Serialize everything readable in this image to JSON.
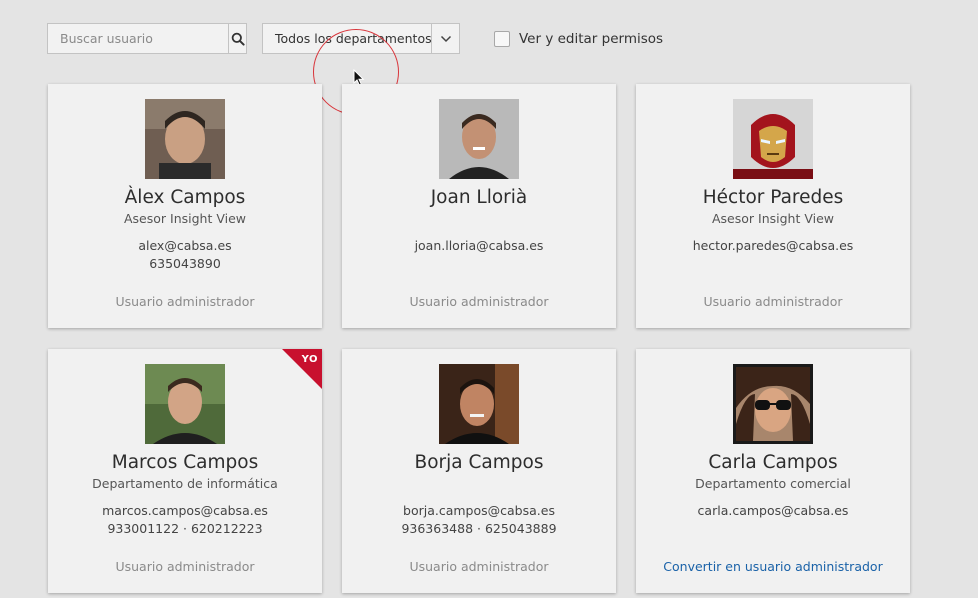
{
  "search": {
    "placeholder": "Buscar usuario",
    "value": ""
  },
  "department_filter": {
    "selected": "Todos los departamentos"
  },
  "permissions_toggle": {
    "label": "Ver y editar permisos",
    "checked": false
  },
  "users": [
    {
      "name": "Àlex Campos",
      "role": "Asesor Insight View",
      "email": "alex@cabsa.es",
      "phones": "635043890",
      "status": "Usuario administrador",
      "status_type": "text",
      "badge": ""
    },
    {
      "name": "Joan Llorià",
      "role": "",
      "email": "joan.lloria@cabsa.es",
      "phones": "",
      "status": "Usuario administrador",
      "status_type": "text",
      "badge": ""
    },
    {
      "name": "Héctor Paredes",
      "role": "Asesor Insight View",
      "email": "hector.paredes@cabsa.es",
      "phones": "",
      "status": "Usuario administrador",
      "status_type": "text",
      "badge": ""
    },
    {
      "name": "Marcos Campos",
      "role": "Departamento de informática",
      "email": "marcos.campos@cabsa.es",
      "phones": "933001122  ·  620212223",
      "status": "Usuario administrador",
      "status_type": "text",
      "badge": "YO"
    },
    {
      "name": "Borja Campos",
      "role": "",
      "email": "borja.campos@cabsa.es",
      "phones": "936363488  ·  625043889",
      "status": "Usuario administrador",
      "status_type": "text",
      "badge": ""
    },
    {
      "name": "Carla Campos",
      "role": "Departamento comercial",
      "email": "carla.campos@cabsa.es",
      "phones": "",
      "status": "Convertir en usuario administrador",
      "status_type": "link",
      "badge": ""
    }
  ],
  "colors": {
    "accent_red": "#c8102e",
    "link_blue": "#1a62a8",
    "background": "#e4e4e4",
    "card": "#f1f1f1"
  },
  "icons": {
    "search": "search-icon",
    "chevron": "chevron-down-icon",
    "cursor": "mouse-pointer-icon"
  }
}
